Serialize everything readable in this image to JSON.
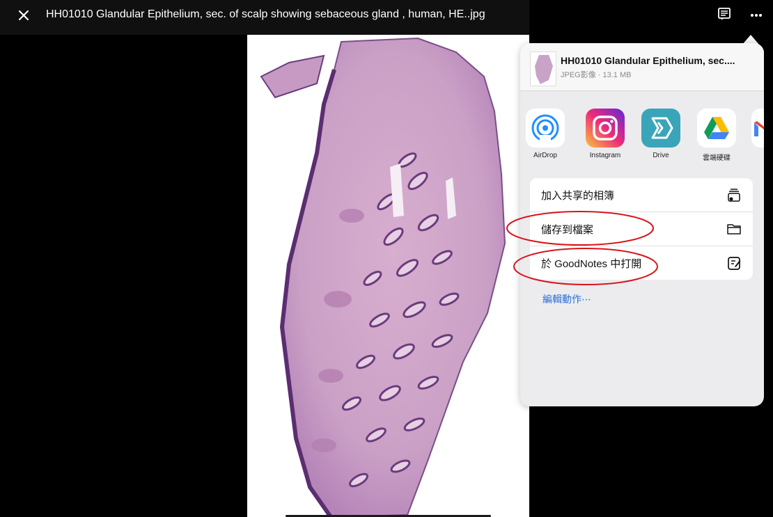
{
  "viewer": {
    "title": "HH01010 Glandular Epithelium, sec. of scalp showing sebaceous gland , human, HE..jpg"
  },
  "share_sheet": {
    "file_name": "HH01010 Glandular Epithelium, sec....",
    "file_meta": "JPEG影像 · 13.1 MB",
    "apps": [
      {
        "label": "AirDrop",
        "icon": "airdrop-icon"
      },
      {
        "label": "Instagram",
        "icon": "instagram-icon"
      },
      {
        "label": "Drive",
        "icon": "drive-icon"
      },
      {
        "label": "雲端硬碟",
        "icon": "google-drive-icon"
      }
    ],
    "actions": [
      {
        "label": "加入共享的相簿",
        "icon": "shared-album-icon"
      },
      {
        "label": "儲存到檔案",
        "icon": "folder-icon"
      },
      {
        "label": "於 GoodNotes 中打開",
        "icon": "goodnotes-icon"
      }
    ],
    "edit_actions_label": "編輯動作⋯"
  },
  "colors": {
    "accent": "#2f6fd6",
    "annotation": "#d9141a",
    "sheet_bg": "#ececee"
  }
}
